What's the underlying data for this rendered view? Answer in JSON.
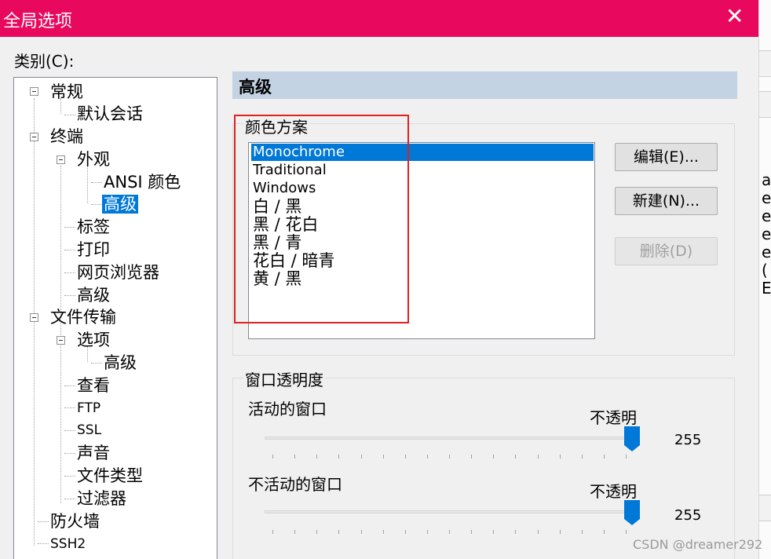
{
  "window": {
    "title": "全局选项",
    "close_glyph": "✕"
  },
  "category_label": "类别(C):",
  "tree": {
    "items": [
      {
        "label": "常规"
      },
      {
        "label": "默认会话"
      },
      {
        "label": "终端"
      },
      {
        "label": "外观"
      },
      {
        "label": "ANSI 颜色"
      },
      {
        "label": "高级",
        "selected": true
      },
      {
        "label": "标签"
      },
      {
        "label": "打印"
      },
      {
        "label": "网页浏览器"
      },
      {
        "label": "高级"
      },
      {
        "label": "文件传输"
      },
      {
        "label": "选项"
      },
      {
        "label": "高级"
      },
      {
        "label": "查看"
      },
      {
        "label": "FTP"
      },
      {
        "label": "SSL"
      },
      {
        "label": "声音"
      },
      {
        "label": "文件类型"
      },
      {
        "label": "过滤器"
      },
      {
        "label": "防火墙"
      },
      {
        "label": "SSH2"
      }
    ]
  },
  "section_title": "高级",
  "color_scheme": {
    "group_title": "颜色方案",
    "items": [
      {
        "label": "Monochrome",
        "selected": true
      },
      {
        "label": "Traditional"
      },
      {
        "label": "Windows"
      },
      {
        "label": "白 / 黑"
      },
      {
        "label": "黑 / 花白"
      },
      {
        "label": "黑 / 青"
      },
      {
        "label": "花白 / 暗青"
      },
      {
        "label": "黄 / 黑"
      }
    ],
    "buttons": {
      "edit": "编辑(E)...",
      "new": "新建(N)...",
      "delete": "删除(D)"
    }
  },
  "transparency": {
    "group_title": "窗口透明度",
    "active": {
      "label": "活动的窗口",
      "end_label": "不透明",
      "value": "255",
      "level": 1.0
    },
    "inactive": {
      "label": "不活动的窗口",
      "end_label": "不透明",
      "value": "255",
      "level": 1.0
    }
  },
  "right_fragments": [
    "a",
    "e",
    "e",
    "e",
    "e",
    "(",
    "E"
  ],
  "watermark": "CSDN @dreamer292",
  "colors": {
    "title_bar": "#e8095f",
    "selection": "#0078d7",
    "section_header": "#c3d3e3",
    "highlight_box": "#e02020"
  }
}
